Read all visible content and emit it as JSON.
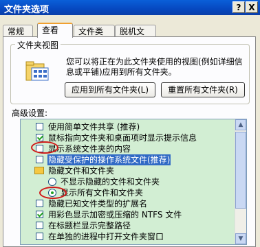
{
  "window": {
    "title": "文件夹选项",
    "help_label": "?",
    "close_label": "X"
  },
  "tabs": [
    {
      "label": "常规"
    },
    {
      "label": "查看"
    },
    {
      "label": "文件类型"
    },
    {
      "label": "脱机文件"
    }
  ],
  "folder_view": {
    "group_title": "文件夹视图",
    "description": "您可以将正在为此文件夹使用的视图(例如详细信息或平铺)应用到所有文件夹。",
    "apply_all_button": "应用到所有文件夹(L)",
    "reset_all_button": "重置所有文件夹(R)"
  },
  "advanced": {
    "label": "高级设置:",
    "items": [
      {
        "kind": "checkbox",
        "checked": false,
        "label": "使用简单文件共享 (推荐)"
      },
      {
        "kind": "checkbox",
        "checked": true,
        "label": "鼠标指向文件夹和桌面项时显示提示信息"
      },
      {
        "kind": "checkbox",
        "checked": false,
        "label": "显示系统文件夹的内容"
      },
      {
        "kind": "checkbox",
        "checked": false,
        "label": "隐藏受保护的操作系统文件(推荐)",
        "highlighted": true
      },
      {
        "kind": "folder",
        "label": "隐藏文件和文件夹"
      },
      {
        "kind": "radio",
        "checked": false,
        "label": "不显示隐藏的文件和文件夹"
      },
      {
        "kind": "radio",
        "checked": true,
        "label": "显示所有文件和文件夹"
      },
      {
        "kind": "checkbox",
        "checked": false,
        "label": "隐藏已知文件类型的扩展名"
      },
      {
        "kind": "checkbox",
        "checked": true,
        "label": "用彩色显示加密或压缩的 NTFS 文件"
      },
      {
        "kind": "checkbox",
        "checked": false,
        "label": "在标题栏显示完整路径"
      },
      {
        "kind": "checkbox",
        "checked": false,
        "label": "在单独的进程中打开文件夹窗口"
      }
    ]
  },
  "colors": {
    "title_bar": "#0648c0",
    "list_background": "#d2eed3",
    "selection": "#316ac5",
    "annotation": "#d01818",
    "check": "#21a121"
  }
}
